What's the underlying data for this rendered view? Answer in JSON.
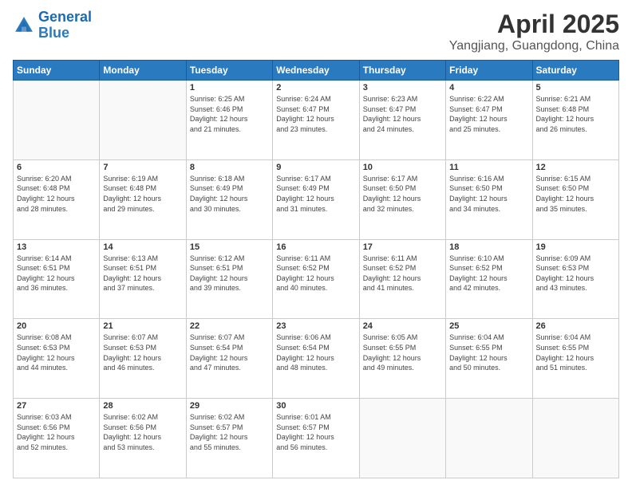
{
  "logo": {
    "line1": "General",
    "line2": "Blue"
  },
  "title": "April 2025",
  "subtitle": "Yangjiang, Guangdong, China",
  "days_of_week": [
    "Sunday",
    "Monday",
    "Tuesday",
    "Wednesday",
    "Thursday",
    "Friday",
    "Saturday"
  ],
  "weeks": [
    [
      {
        "day": "",
        "info": ""
      },
      {
        "day": "",
        "info": ""
      },
      {
        "day": "1",
        "info": "Sunrise: 6:25 AM\nSunset: 6:46 PM\nDaylight: 12 hours\nand 21 minutes."
      },
      {
        "day": "2",
        "info": "Sunrise: 6:24 AM\nSunset: 6:47 PM\nDaylight: 12 hours\nand 23 minutes."
      },
      {
        "day": "3",
        "info": "Sunrise: 6:23 AM\nSunset: 6:47 PM\nDaylight: 12 hours\nand 24 minutes."
      },
      {
        "day": "4",
        "info": "Sunrise: 6:22 AM\nSunset: 6:47 PM\nDaylight: 12 hours\nand 25 minutes."
      },
      {
        "day": "5",
        "info": "Sunrise: 6:21 AM\nSunset: 6:48 PM\nDaylight: 12 hours\nand 26 minutes."
      }
    ],
    [
      {
        "day": "6",
        "info": "Sunrise: 6:20 AM\nSunset: 6:48 PM\nDaylight: 12 hours\nand 28 minutes."
      },
      {
        "day": "7",
        "info": "Sunrise: 6:19 AM\nSunset: 6:48 PM\nDaylight: 12 hours\nand 29 minutes."
      },
      {
        "day": "8",
        "info": "Sunrise: 6:18 AM\nSunset: 6:49 PM\nDaylight: 12 hours\nand 30 minutes."
      },
      {
        "day": "9",
        "info": "Sunrise: 6:17 AM\nSunset: 6:49 PM\nDaylight: 12 hours\nand 31 minutes."
      },
      {
        "day": "10",
        "info": "Sunrise: 6:17 AM\nSunset: 6:50 PM\nDaylight: 12 hours\nand 32 minutes."
      },
      {
        "day": "11",
        "info": "Sunrise: 6:16 AM\nSunset: 6:50 PM\nDaylight: 12 hours\nand 34 minutes."
      },
      {
        "day": "12",
        "info": "Sunrise: 6:15 AM\nSunset: 6:50 PM\nDaylight: 12 hours\nand 35 minutes."
      }
    ],
    [
      {
        "day": "13",
        "info": "Sunrise: 6:14 AM\nSunset: 6:51 PM\nDaylight: 12 hours\nand 36 minutes."
      },
      {
        "day": "14",
        "info": "Sunrise: 6:13 AM\nSunset: 6:51 PM\nDaylight: 12 hours\nand 37 minutes."
      },
      {
        "day": "15",
        "info": "Sunrise: 6:12 AM\nSunset: 6:51 PM\nDaylight: 12 hours\nand 39 minutes."
      },
      {
        "day": "16",
        "info": "Sunrise: 6:11 AM\nSunset: 6:52 PM\nDaylight: 12 hours\nand 40 minutes."
      },
      {
        "day": "17",
        "info": "Sunrise: 6:11 AM\nSunset: 6:52 PM\nDaylight: 12 hours\nand 41 minutes."
      },
      {
        "day": "18",
        "info": "Sunrise: 6:10 AM\nSunset: 6:52 PM\nDaylight: 12 hours\nand 42 minutes."
      },
      {
        "day": "19",
        "info": "Sunrise: 6:09 AM\nSunset: 6:53 PM\nDaylight: 12 hours\nand 43 minutes."
      }
    ],
    [
      {
        "day": "20",
        "info": "Sunrise: 6:08 AM\nSunset: 6:53 PM\nDaylight: 12 hours\nand 44 minutes."
      },
      {
        "day": "21",
        "info": "Sunrise: 6:07 AM\nSunset: 6:53 PM\nDaylight: 12 hours\nand 46 minutes."
      },
      {
        "day": "22",
        "info": "Sunrise: 6:07 AM\nSunset: 6:54 PM\nDaylight: 12 hours\nand 47 minutes."
      },
      {
        "day": "23",
        "info": "Sunrise: 6:06 AM\nSunset: 6:54 PM\nDaylight: 12 hours\nand 48 minutes."
      },
      {
        "day": "24",
        "info": "Sunrise: 6:05 AM\nSunset: 6:55 PM\nDaylight: 12 hours\nand 49 minutes."
      },
      {
        "day": "25",
        "info": "Sunrise: 6:04 AM\nSunset: 6:55 PM\nDaylight: 12 hours\nand 50 minutes."
      },
      {
        "day": "26",
        "info": "Sunrise: 6:04 AM\nSunset: 6:55 PM\nDaylight: 12 hours\nand 51 minutes."
      }
    ],
    [
      {
        "day": "27",
        "info": "Sunrise: 6:03 AM\nSunset: 6:56 PM\nDaylight: 12 hours\nand 52 minutes."
      },
      {
        "day": "28",
        "info": "Sunrise: 6:02 AM\nSunset: 6:56 PM\nDaylight: 12 hours\nand 53 minutes."
      },
      {
        "day": "29",
        "info": "Sunrise: 6:02 AM\nSunset: 6:57 PM\nDaylight: 12 hours\nand 55 minutes."
      },
      {
        "day": "30",
        "info": "Sunrise: 6:01 AM\nSunset: 6:57 PM\nDaylight: 12 hours\nand 56 minutes."
      },
      {
        "day": "",
        "info": ""
      },
      {
        "day": "",
        "info": ""
      },
      {
        "day": "",
        "info": ""
      }
    ]
  ],
  "colors": {
    "header_bg": "#2a7abf",
    "accent": "#1a6bb5"
  }
}
